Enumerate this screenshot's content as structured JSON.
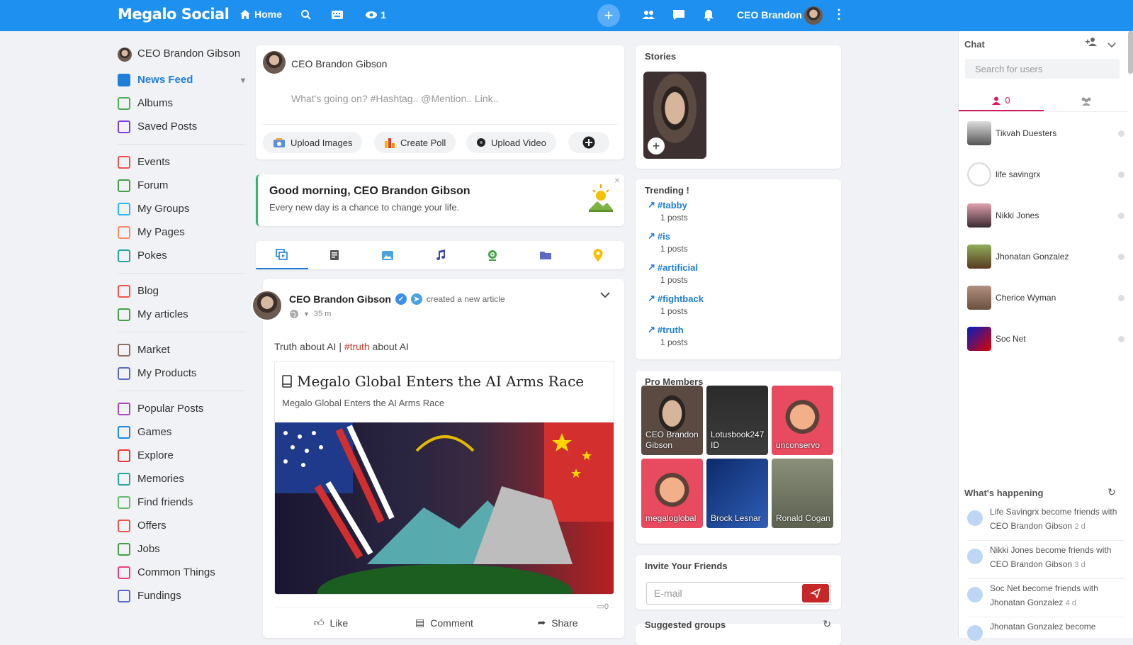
{
  "topbar": {
    "logo": "Megalo Social",
    "home": "Home",
    "views_count": "1",
    "user_name": "CEO Brandon",
    "brand_color": "#1e90f0"
  },
  "sidebar": {
    "user_name": "CEO Brandon Gibson",
    "items": [
      {
        "label": "News Feed",
        "icon": "home-icon",
        "color": "#1e7ed8"
      },
      {
        "label": "Albums",
        "icon": "photo-icon",
        "color": "#4caf50"
      },
      {
        "label": "Saved Posts",
        "icon": "bookmark-icon",
        "color": "#7b3fe4"
      },
      {
        "label": "Events",
        "icon": "calendar-icon",
        "color": "#ef5350"
      },
      {
        "label": "Forum",
        "icon": "list-icon",
        "color": "#43a047"
      },
      {
        "label": "My Groups",
        "icon": "groups-icon",
        "color": "#29b6f6"
      },
      {
        "label": "My Pages",
        "icon": "flag-icon",
        "color": "#ff8a65"
      },
      {
        "label": "Pokes",
        "icon": "poke-icon",
        "color": "#26a69a"
      },
      {
        "label": "Blog",
        "icon": "blog-icon",
        "color": "#ef5350"
      },
      {
        "label": "My articles",
        "icon": "article-icon",
        "color": "#43a047"
      },
      {
        "label": "Market",
        "icon": "store-icon",
        "color": "#8d6e63"
      },
      {
        "label": "My Products",
        "icon": "basket-icon",
        "color": "#5c6bc0"
      },
      {
        "label": "Popular Posts",
        "icon": "popular-icon",
        "color": "#ab47bc"
      },
      {
        "label": "Games",
        "icon": "gamepad-icon",
        "color": "#1e88e5"
      },
      {
        "label": "Explore",
        "icon": "explore-icon",
        "color": "#e53935"
      },
      {
        "label": "Memories",
        "icon": "history-icon",
        "color": "#26a69a"
      },
      {
        "label": "Find friends",
        "icon": "pin-icon",
        "color": "#66bb6a"
      },
      {
        "label": "Offers",
        "icon": "tag-icon",
        "color": "#ef5350"
      },
      {
        "label": "Jobs",
        "icon": "briefcase-icon",
        "color": "#43a047"
      },
      {
        "label": "Common Things",
        "icon": "common-icon",
        "color": "#ec407a"
      },
      {
        "label": "Fundings",
        "icon": "dollar-icon",
        "color": "#5c6bc0"
      }
    ]
  },
  "composer": {
    "name": "CEO Brandon Gibson",
    "placeholder": "What's going on? #Hashtag.. @Mention.. Link..",
    "upload_images": "Upload Images",
    "create_poll": "Create Poll",
    "upload_video": "Upload Video"
  },
  "greeting": {
    "title": "Good morning, CEO Brandon Gibson",
    "subtitle": "Every new day is a chance to change your life."
  },
  "post": {
    "author": "CEO Brandon Gibson",
    "action": "created a new article",
    "time": "35 m",
    "text_prefix": "Truth about AI | ",
    "hashtag": "#truth",
    "text_suffix": " about AI",
    "article_title": "Megalo Global Enters the AI Arms Race",
    "article_subtitle": "Megalo Global Enters the AI Arms Race",
    "comment_count": "0",
    "like": "Like",
    "comment": "Comment",
    "share": "Share"
  },
  "stories": {
    "title": "Stories"
  },
  "trending": {
    "title": "Trending !",
    "items": [
      {
        "tag": "#tabby",
        "count": "1 posts"
      },
      {
        "tag": "#is",
        "count": "1 posts"
      },
      {
        "tag": "#artificial",
        "count": "1 posts"
      },
      {
        "tag": "#fightback",
        "count": "1 posts"
      },
      {
        "tag": "#truth",
        "count": "1 posts"
      }
    ]
  },
  "pro_members": {
    "title": "Pro Members",
    "members": [
      {
        "name": "CEO Brandon Gibson"
      },
      {
        "name": "Lotusbook247 ID"
      },
      {
        "name": "unconservo"
      },
      {
        "name": "megaloglobal"
      },
      {
        "name": "Brock Lesnar"
      },
      {
        "name": "Ronald Cogan"
      }
    ]
  },
  "invite": {
    "title": "Invite Your Friends",
    "placeholder": "E-mail"
  },
  "suggested": {
    "title": "Suggested groups"
  },
  "chat": {
    "title": "Chat",
    "search_placeholder": "Search for users",
    "online_count": "0",
    "users": [
      {
        "name": "Tikvah Duesters"
      },
      {
        "name": "life savingrx"
      },
      {
        "name": "Nikki Jones"
      },
      {
        "name": "Jhonatan Gonzalez"
      },
      {
        "name": "Cherice Wyman"
      },
      {
        "name": "Soc Net"
      }
    ],
    "happening_title": "What's happening",
    "happening": [
      {
        "text": "Life Savingrx become friends with",
        "who": "CEO Brandon Gibson",
        "time": "2 d"
      },
      {
        "text": "Nikki Jones become friends with",
        "who": "CEO Brandon Gibson",
        "time": "3 d"
      },
      {
        "text": "Soc Net become friends with",
        "who": "Jhonatan Gonzalez",
        "time": "4 d"
      },
      {
        "text": "Jhonatan Gonzalez become",
        "who": "",
        "time": ""
      }
    ]
  }
}
